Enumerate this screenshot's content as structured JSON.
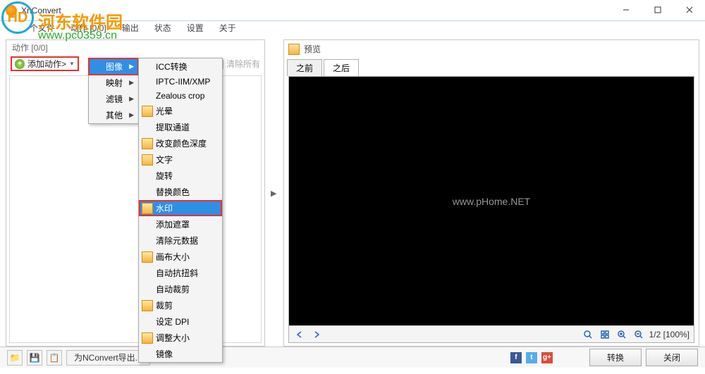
{
  "title": "XnConvert",
  "overlay": {
    "logo_text": "河东软件园",
    "url": "www.pc0359.cn"
  },
  "menubar": {
    "files": "个文件",
    "actions": "动作 [0/0]",
    "output": "输出",
    "status": "状态",
    "settings": "设置",
    "about": "关于"
  },
  "left": {
    "header": "动作 [0/0]",
    "add_action": "添加动作>",
    "clear_all": "清除所有"
  },
  "menu1": {
    "image": "图像",
    "map": "映射",
    "filter": "滤镜",
    "other": "其他"
  },
  "menu2": [
    {
      "k": "icc",
      "label": "ICC转换",
      "icon": false
    },
    {
      "k": "iptc",
      "label": "IPTC-IIM/XMP",
      "icon": false
    },
    {
      "k": "zealous",
      "label": "Zealous crop",
      "icon": false
    },
    {
      "k": "vignette",
      "label": "光晕",
      "icon": true
    },
    {
      "k": "extract",
      "label": "提取通道",
      "icon": false
    },
    {
      "k": "depth",
      "label": "改变颜色深度",
      "icon": true
    },
    {
      "k": "text",
      "label": "文字",
      "icon": true
    },
    {
      "k": "rotate",
      "label": "旋转",
      "icon": false
    },
    {
      "k": "replace",
      "label": "替换颜色",
      "icon": false
    },
    {
      "k": "watermark",
      "label": "水印",
      "icon": true,
      "hl": true,
      "boxed": true
    },
    {
      "k": "mask",
      "label": "添加遮罩",
      "icon": false
    },
    {
      "k": "clearmeta",
      "label": "清除元数据",
      "icon": false
    },
    {
      "k": "canvas",
      "label": "画布大小",
      "icon": true
    },
    {
      "k": "deskew",
      "label": "自动抗扭斜",
      "icon": false
    },
    {
      "k": "autocrop",
      "label": "自动裁剪",
      "icon": false
    },
    {
      "k": "crop",
      "label": "裁剪",
      "icon": true
    },
    {
      "k": "dpi",
      "label": "设定 DPI",
      "icon": false
    },
    {
      "k": "resize",
      "label": "调整大小",
      "icon": true
    },
    {
      "k": "mirror",
      "label": "镜像",
      "icon": false
    }
  ],
  "right": {
    "header": "预览",
    "tab_before": "之前",
    "tab_after": "之后",
    "watermark_text": "www.pHome.NET",
    "zoom_status": "1/2  [100%]"
  },
  "footer": {
    "export_label": "为NConvert导出...",
    "convert": "转换",
    "close": "关闭"
  }
}
